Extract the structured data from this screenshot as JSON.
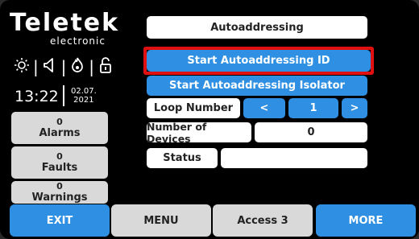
{
  "logo": {
    "brand": "Teletek",
    "sub": "electronic"
  },
  "status_icons": [
    "sun-icon",
    "speaker-icon",
    "fire-icon",
    "unlock-icon"
  ],
  "clock": {
    "time": "13:22",
    "date_line1": "02.07.",
    "date_line2": "2021"
  },
  "sidebar": [
    {
      "count": "0",
      "label": "Alarms"
    },
    {
      "count": "0",
      "label": "Faults"
    },
    {
      "count": "0",
      "label": "Warnings"
    }
  ],
  "main": {
    "title": "Autoaddressing",
    "start_id": "Start Autoaddressing ID",
    "start_isolator": "Start Autoaddressing Isolator",
    "loop_label": "Loop Number",
    "loop_prev": "<",
    "loop_value": "1",
    "loop_next": ">",
    "devices_label": "Number of Devices",
    "devices_value": "0",
    "status_label": "Status",
    "status_value": ""
  },
  "bottom": {
    "exit": "EXIT",
    "menu": "MENU",
    "access": "Access 3",
    "more": "MORE"
  },
  "colors": {
    "accent": "#2f8fe3",
    "highlight": "#e01010",
    "panel": "#d9d9d9"
  }
}
